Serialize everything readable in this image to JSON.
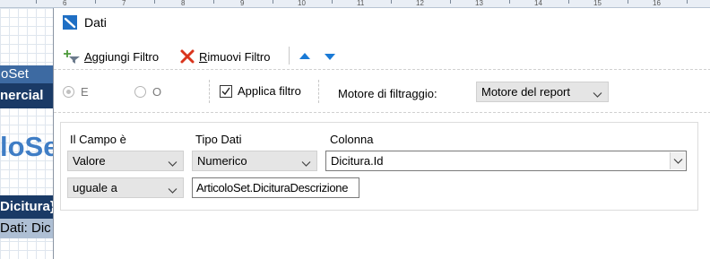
{
  "ruler": {
    "numbers": [
      "6",
      "7",
      "8",
      "9",
      "10",
      "11",
      "12",
      "13",
      "14",
      "15",
      "16"
    ]
  },
  "background": {
    "band1": "oSet",
    "band2": "nercial",
    "band3": "loSet",
    "band4": "Dicitura}",
    "band5": "Dati:  Dic"
  },
  "dialog": {
    "title": "Dati",
    "toolbar": {
      "add_filter_label_u": "A",
      "add_filter_label_rest": "ggiungi Filtro",
      "remove_filter_label_u": "R",
      "remove_filter_label_rest": "imuovi Filtro"
    },
    "options": {
      "radio_and": "E",
      "radio_or": "O",
      "apply_filter": "Applica filtro",
      "engine_label": "Motore di filtraggio:",
      "engine_value": "Motore del report"
    },
    "filter": {
      "header_field": "Il Campo è",
      "header_datatype": "Tipo Dati",
      "header_column": "Colonna",
      "field_value": "Valore",
      "datatype_value": "Numerico",
      "column_value": "Dicitura.Id",
      "condition_value": "uguale a",
      "expression_value": "ArticoloSet.DicituraDescrizione"
    }
  },
  "colors": {
    "accent_blue": "#1f6fc4",
    "remove_red": "#d9341c",
    "arrow_blue": "#1a7ad6"
  }
}
